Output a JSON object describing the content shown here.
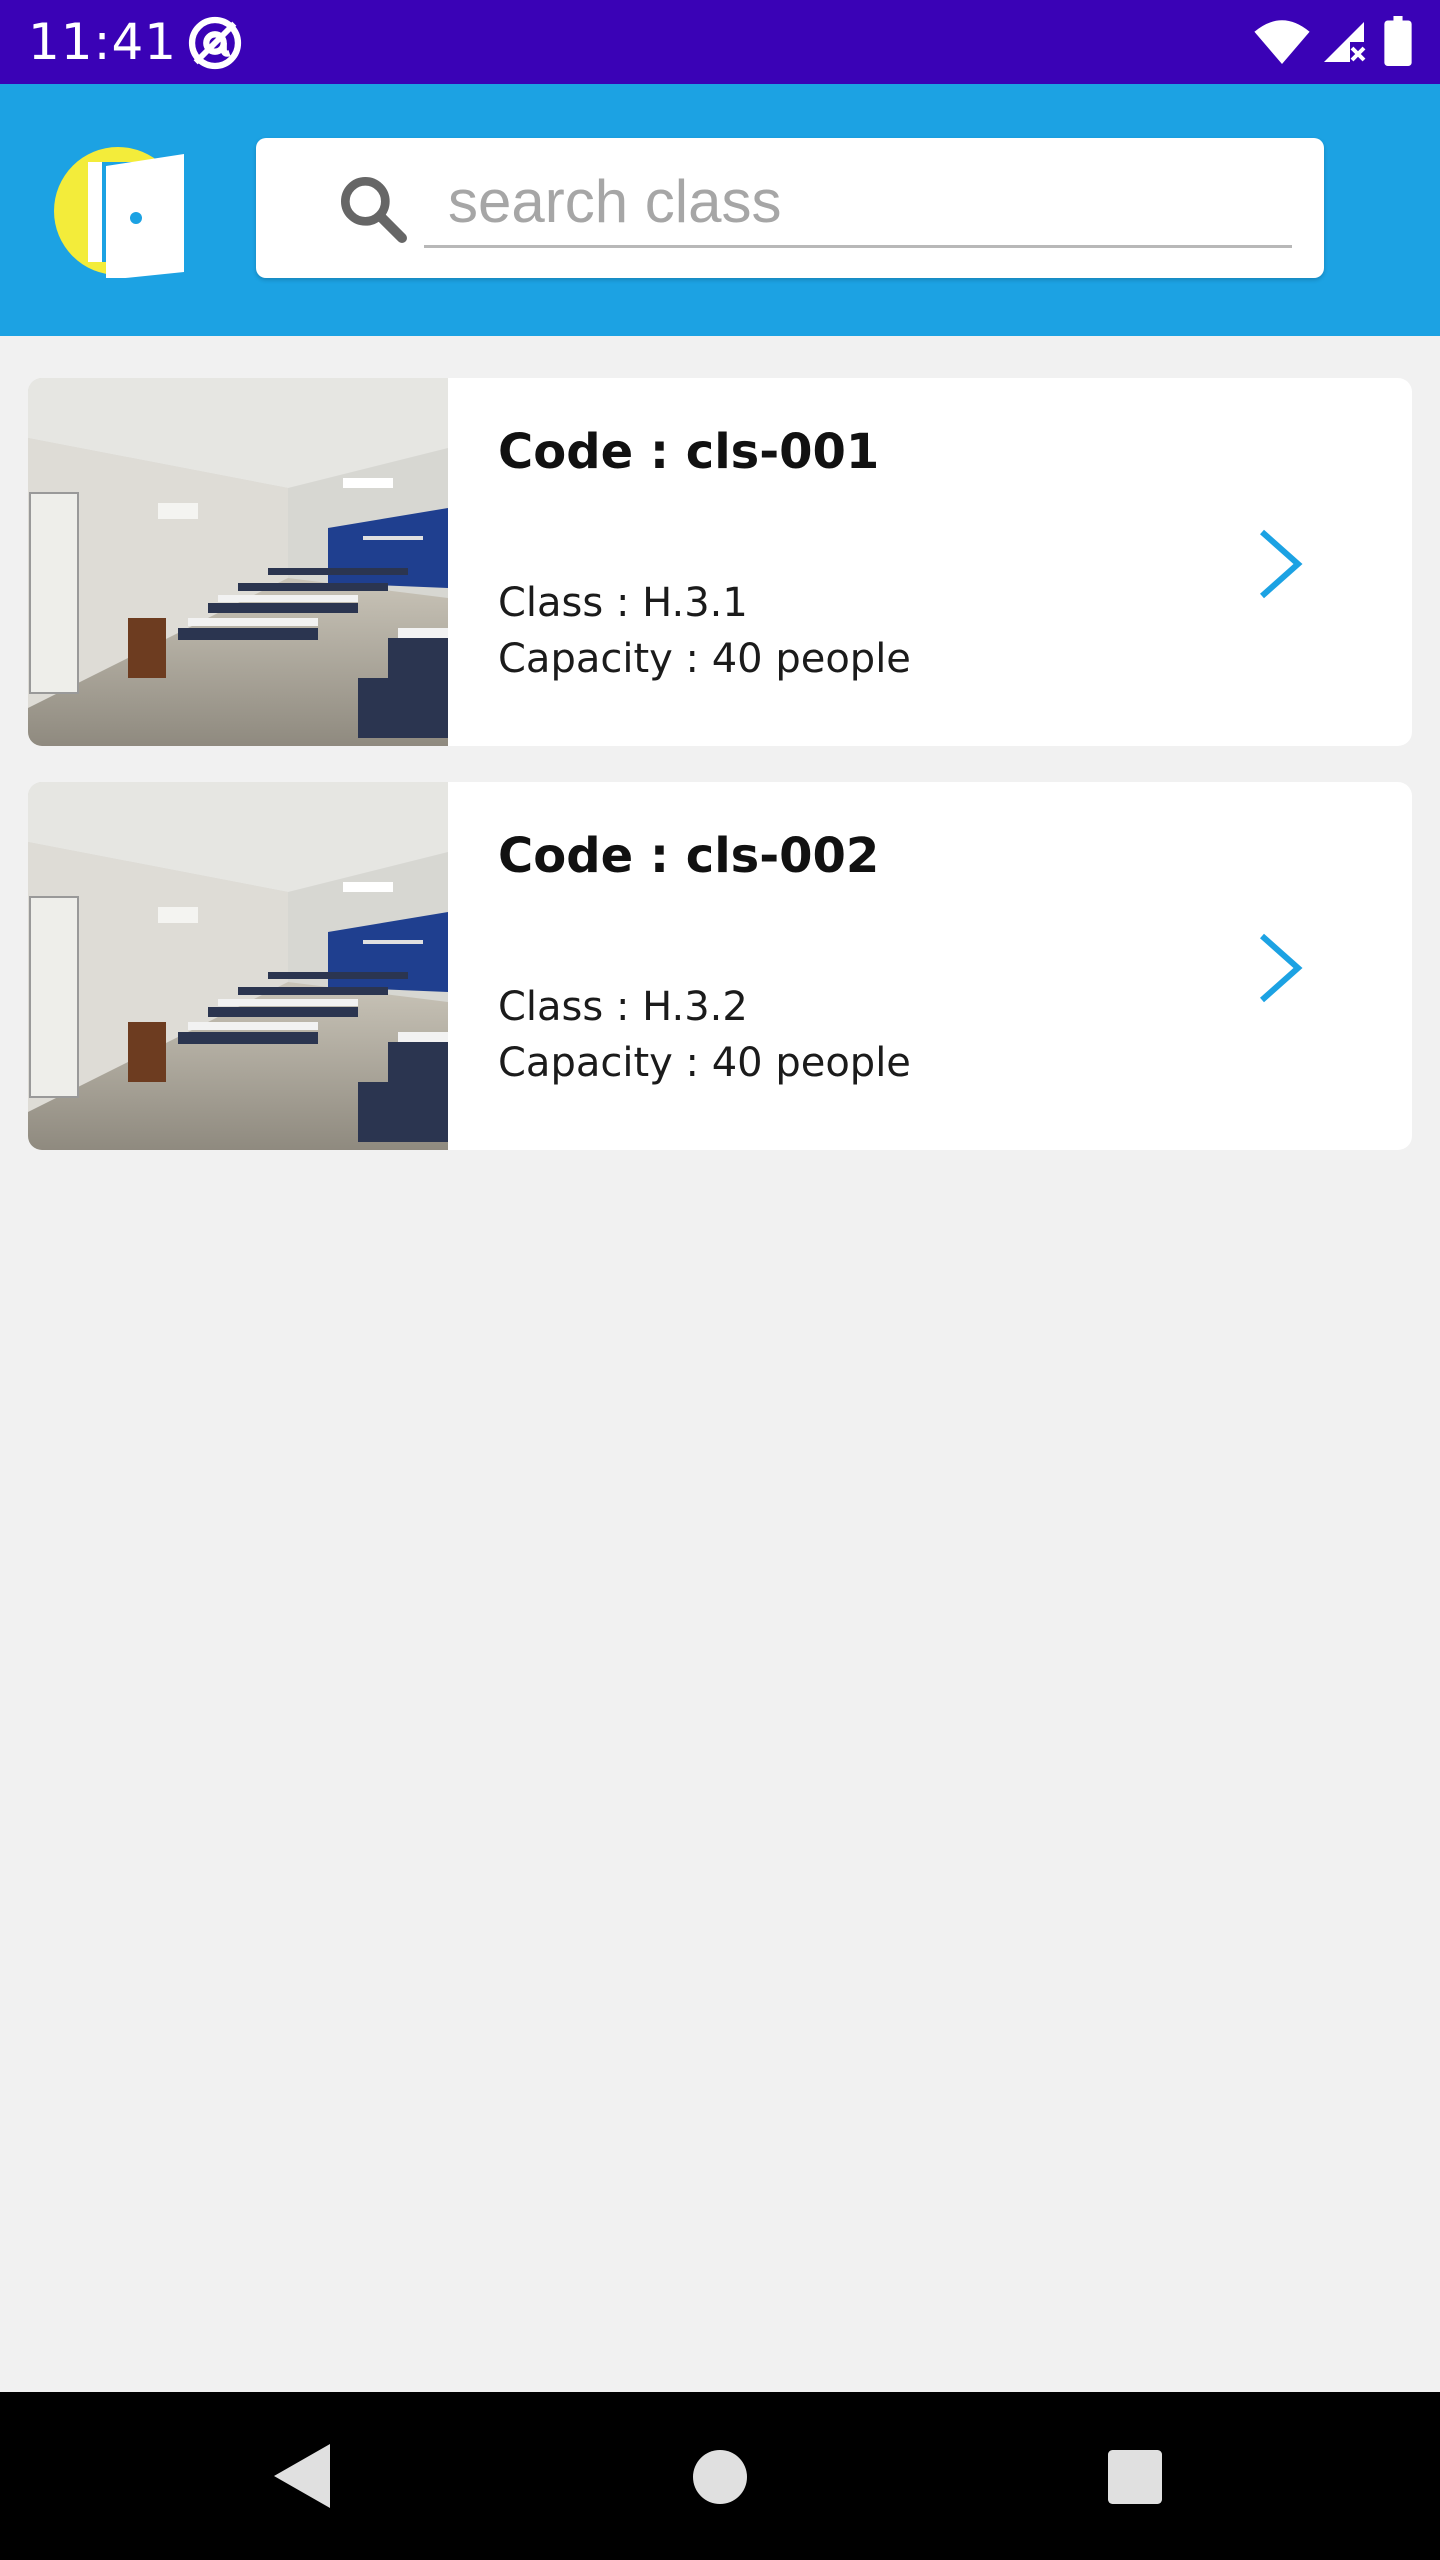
{
  "status_bar": {
    "time": "11:41",
    "icons": [
      "at-sign-icon",
      "wifi-icon",
      "signal-no-service-icon",
      "battery-icon"
    ]
  },
  "header": {
    "logo_icon": "door-logo-icon",
    "search": {
      "placeholder": "search class",
      "value": "",
      "icon": "search-icon"
    }
  },
  "classes": [
    {
      "code": "Code : cls-001",
      "class_label": "Class : H.3.1",
      "capacity": "Capacity : 40 people",
      "image": "classroom-photo",
      "action_icon": "chevron-right-icon"
    },
    {
      "code": "Code : cls-002",
      "class_label": "Class : H.3.2",
      "capacity": "Capacity : 40 people",
      "image": "classroom-photo",
      "action_icon": "chevron-right-icon"
    }
  ],
  "nav_bar": {
    "buttons": [
      "back-icon",
      "home-icon",
      "recent-apps-icon"
    ]
  },
  "colors": {
    "status_bar": "#3a02b6",
    "app_bar": "#1ca2e3",
    "background": "#f1f1f1",
    "accent": "#1ca2e3",
    "logo_yellow": "#f3ec3a"
  }
}
